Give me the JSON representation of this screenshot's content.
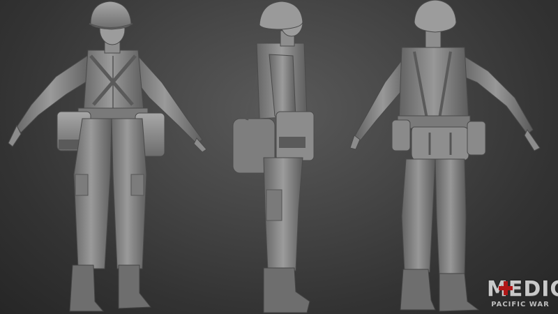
{
  "logo": {
    "title": "MEDIC",
    "subtitle": "PACIFIC WAR"
  },
  "figures": [
    "front-view",
    "side-view",
    "back-view"
  ],
  "colors": {
    "background": "#3a3a3a",
    "clay": "#8a8a8a",
    "clay_dark": "#5c5c5c",
    "clay_light": "#a8a8a8",
    "logo_red": "#b01818"
  }
}
